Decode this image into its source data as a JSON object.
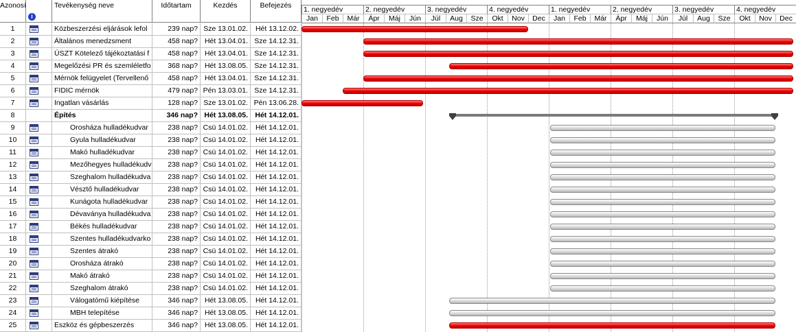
{
  "columns": {
    "id": "Azonosít",
    "name": "Tevékenység neve",
    "duration": "Időtartam",
    "start": "Kezdés",
    "finish": "Befejezés"
  },
  "timescale": {
    "quarters": [
      "1. negyedév",
      "2. negyedév",
      "3. negyedév",
      "4. negyedév",
      "1. negyedév",
      "2. negyedév",
      "3. negyedév",
      "4. negyedév"
    ],
    "months": [
      "Jan",
      "Feb",
      "Már",
      "Ápr",
      "Máj",
      "Jún",
      "Júl",
      "Aug",
      "Sze",
      "Okt",
      "Nov",
      "Dec",
      "Jan",
      "Feb",
      "Már",
      "Ápr",
      "Máj",
      "Jún",
      "Júl",
      "Aug",
      "Sze",
      "Okt",
      "Nov",
      "Dec"
    ]
  },
  "colors": {
    "task_bar": "#e60000",
    "sub_bar": "#d8d8d8",
    "summary": "#404040"
  },
  "tasks": [
    {
      "id": "1",
      "name": "Közbeszerzési eljárások lefol",
      "duration": "239 nap?",
      "start": "Sze 13.01.02.",
      "finish": "Hét 13.12.02.",
      "indent": 0,
      "bold": false,
      "bar": "red",
      "from": 0.0,
      "to": 11.0
    },
    {
      "id": "2",
      "name": "Általános menedzsment",
      "duration": "458 nap?",
      "start": "Hét 13.04.01.",
      "finish": "Sze 14.12.31.",
      "indent": 0,
      "bold": false,
      "bar": "red",
      "from": 3.0,
      "to": 24.0
    },
    {
      "id": "3",
      "name": "ÚSZT Kötelező tájékoztatási f",
      "duration": "458 nap?",
      "start": "Hét 13.04.01.",
      "finish": "Sze 14.12.31.",
      "indent": 0,
      "bold": false,
      "bar": "red",
      "from": 3.0,
      "to": 24.0
    },
    {
      "id": "4",
      "name": "Megelőzési PR és szemléletfo",
      "duration": "368 nap?",
      "start": "Hét 13.08.05.",
      "finish": "Sze 14.12.31.",
      "indent": 0,
      "bold": false,
      "bar": "red",
      "from": 7.15,
      "to": 24.0
    },
    {
      "id": "5",
      "name": "Mérnök felügyelet (Tervellenő",
      "duration": "458 nap?",
      "start": "Hét 13.04.01.",
      "finish": "Sze 14.12.31.",
      "indent": 0,
      "bold": false,
      "bar": "red",
      "from": 3.0,
      "to": 24.0
    },
    {
      "id": "6",
      "name": "FIDIC mérnök",
      "duration": "479 nap?",
      "start": "Pén 13.03.01.",
      "finish": "Sze 14.12.31.",
      "indent": 0,
      "bold": false,
      "bar": "red",
      "from": 2.0,
      "to": 24.0
    },
    {
      "id": "7",
      "name": "Ingatlan vásárlás",
      "duration": "128 nap?",
      "start": "Sze 13.01.02.",
      "finish": "Pén 13.06.28.",
      "indent": 0,
      "bold": false,
      "bar": "red",
      "from": 0.0,
      "to": 5.9
    },
    {
      "id": "8",
      "name": "Építés",
      "duration": "346 nap?",
      "start": "Hét 13.08.05.",
      "finish": "Hét 14.12.01.",
      "indent": 0,
      "bold": true,
      "bar": "summary",
      "from": 7.15,
      "to": 23.0
    },
    {
      "id": "9",
      "name": "Orosháza hulladékudvar",
      "duration": "238 nap?",
      "start": "Csü 14.01.02.",
      "finish": "Hét 14.12.01.",
      "indent": 1,
      "bold": false,
      "bar": "grey",
      "from": 12.05,
      "to": 23.0
    },
    {
      "id": "10",
      "name": "Gyula hulladékudvar",
      "duration": "238 nap?",
      "start": "Csü 14.01.02.",
      "finish": "Hét 14.12.01.",
      "indent": 1,
      "bold": false,
      "bar": "grey",
      "from": 12.05,
      "to": 23.0
    },
    {
      "id": "11",
      "name": "Makó hulladékudvar",
      "duration": "238 nap?",
      "start": "Csü 14.01.02.",
      "finish": "Hét 14.12.01.",
      "indent": 1,
      "bold": false,
      "bar": "grey",
      "from": 12.05,
      "to": 23.0
    },
    {
      "id": "12",
      "name": "Mezőhegyes hulladékudv",
      "duration": "238 nap?",
      "start": "Csü 14.01.02.",
      "finish": "Hét 14.12.01.",
      "indent": 1,
      "bold": false,
      "bar": "grey",
      "from": 12.05,
      "to": 23.0
    },
    {
      "id": "13",
      "name": "Szeghalom hulladékudva",
      "duration": "238 nap?",
      "start": "Csü 14.01.02.",
      "finish": "Hét 14.12.01.",
      "indent": 1,
      "bold": false,
      "bar": "grey",
      "from": 12.05,
      "to": 23.0
    },
    {
      "id": "14",
      "name": "Vésztő hulladékudvar",
      "duration": "238 nap?",
      "start": "Csü 14.01.02.",
      "finish": "Hét 14.12.01.",
      "indent": 1,
      "bold": false,
      "bar": "grey",
      "from": 12.05,
      "to": 23.0
    },
    {
      "id": "15",
      "name": "Kunágota hulladékudvar",
      "duration": "238 nap?",
      "start": "Csü 14.01.02.",
      "finish": "Hét 14.12.01.",
      "indent": 1,
      "bold": false,
      "bar": "grey",
      "from": 12.05,
      "to": 23.0
    },
    {
      "id": "16",
      "name": "Dévaványa hulladékudva",
      "duration": "238 nap?",
      "start": "Csü 14.01.02.",
      "finish": "Hét 14.12.01.",
      "indent": 1,
      "bold": false,
      "bar": "grey",
      "from": 12.05,
      "to": 23.0
    },
    {
      "id": "17",
      "name": "Békés hulladékudvar",
      "duration": "238 nap?",
      "start": "Csü 14.01.02.",
      "finish": "Hét 14.12.01.",
      "indent": 1,
      "bold": false,
      "bar": "grey",
      "from": 12.05,
      "to": 23.0
    },
    {
      "id": "18",
      "name": "Szentes hulladékudvarko",
      "duration": "238 nap?",
      "start": "Csü 14.01.02.",
      "finish": "Hét 14.12.01.",
      "indent": 1,
      "bold": false,
      "bar": "grey",
      "from": 12.05,
      "to": 23.0
    },
    {
      "id": "19",
      "name": "Szentes átrakó",
      "duration": "238 nap?",
      "start": "Csü 14.01.02.",
      "finish": "Hét 14.12.01.",
      "indent": 1,
      "bold": false,
      "bar": "grey",
      "from": 12.05,
      "to": 23.0
    },
    {
      "id": "20",
      "name": "Orosháza átrakó",
      "duration": "238 nap?",
      "start": "Csü 14.01.02.",
      "finish": "Hét 14.12.01.",
      "indent": 1,
      "bold": false,
      "bar": "grey",
      "from": 12.05,
      "to": 23.0
    },
    {
      "id": "21",
      "name": "Makó átrakó",
      "duration": "238 nap?",
      "start": "Csü 14.01.02.",
      "finish": "Hét 14.12.01.",
      "indent": 1,
      "bold": false,
      "bar": "grey",
      "from": 12.05,
      "to": 23.0
    },
    {
      "id": "22",
      "name": "Szeghalom átrakó",
      "duration": "238 nap?",
      "start": "Csü 14.01.02.",
      "finish": "Hét 14.12.01.",
      "indent": 1,
      "bold": false,
      "bar": "grey",
      "from": 12.05,
      "to": 23.0
    },
    {
      "id": "23",
      "name": "Válogatómű kiépítése",
      "duration": "346 nap?",
      "start": "Hét 13.08.05.",
      "finish": "Hét 14.12.01.",
      "indent": 1,
      "bold": false,
      "bar": "grey",
      "from": 7.15,
      "to": 23.0
    },
    {
      "id": "24",
      "name": "MBH telepítése",
      "duration": "346 nap?",
      "start": "Hét 13.08.05.",
      "finish": "Hét 14.12.01.",
      "indent": 1,
      "bold": false,
      "bar": "grey",
      "from": 7.15,
      "to": 23.0
    },
    {
      "id": "25",
      "name": "Eszköz és gépbeszerzés",
      "duration": "346 nap?",
      "start": "Hét 13.08.05.",
      "finish": "Hét 14.12.01.",
      "indent": 0,
      "bold": false,
      "bar": "red",
      "from": 7.15,
      "to": 23.0
    }
  ]
}
